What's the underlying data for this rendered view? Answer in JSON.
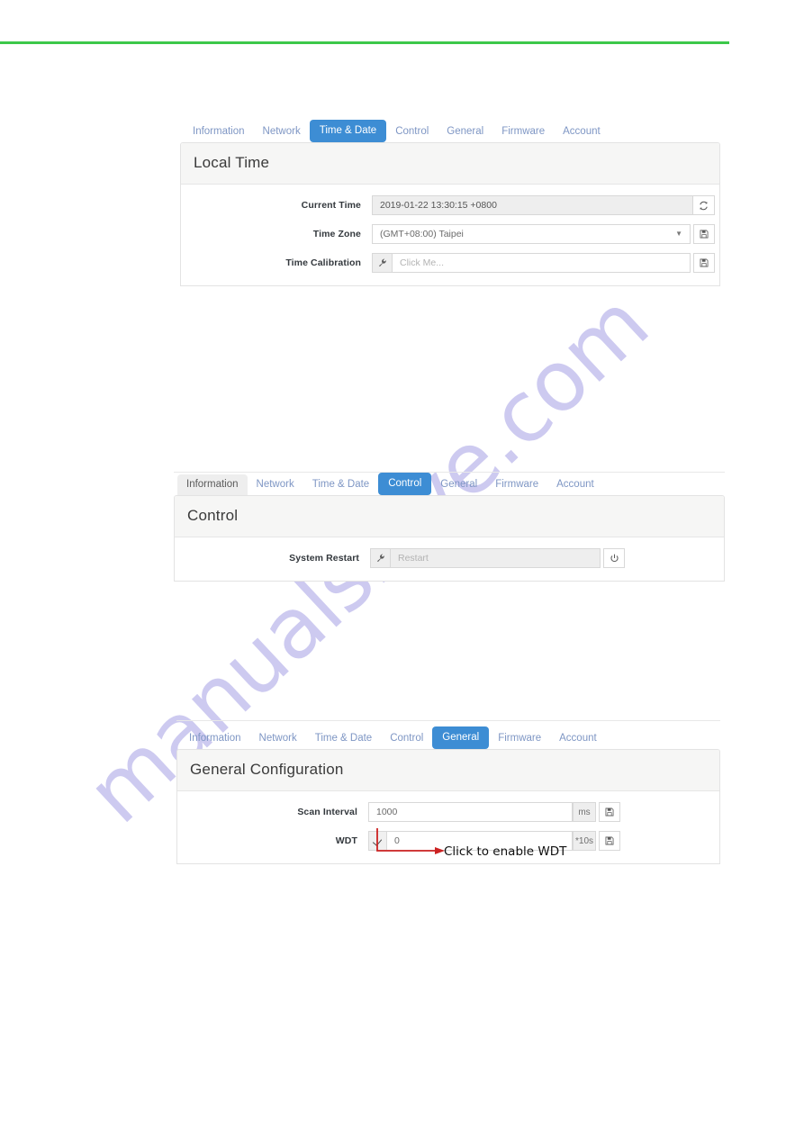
{
  "page": {
    "accent_green": "#3cc84a",
    "watermark_text": "manualshive.com",
    "watermark_color": "#c9c6ef"
  },
  "tabs_common": [
    "Information",
    "Network",
    "Time & Date",
    "Control",
    "General",
    "Firmware",
    "Account"
  ],
  "panels": [
    {
      "id": "time-and-date",
      "tabs": [
        {
          "label": "Information",
          "state": "normal"
        },
        {
          "label": "Network",
          "state": "normal"
        },
        {
          "label": "Time & Date",
          "state": "active"
        },
        {
          "label": "Control",
          "state": "normal"
        },
        {
          "label": "General",
          "state": "normal"
        },
        {
          "label": "Firmware",
          "state": "normal"
        },
        {
          "label": "Account",
          "state": "normal"
        }
      ],
      "title": "Local Time",
      "rows": [
        {
          "label": "Current Time",
          "value": "2019-01-22 13:30:15 +0800",
          "placeholder": "",
          "trailing_icon": "refresh-icon"
        },
        {
          "label": "Time Zone",
          "value": "(GMT+08:00) Taipei",
          "placeholder": "",
          "trailing_icon": "save-icon"
        },
        {
          "label": "Time Calibration",
          "value": "",
          "placeholder": "Click Me...",
          "leading_icon": "wrench-icon",
          "trailing_icon": "save-icon"
        }
      ]
    },
    {
      "id": "control",
      "tabs": [
        {
          "label": "Information",
          "state": "hovered"
        },
        {
          "label": "Network",
          "state": "normal"
        },
        {
          "label": "Time & Date",
          "state": "normal"
        },
        {
          "label": "Control",
          "state": "active"
        },
        {
          "label": "General",
          "state": "normal"
        },
        {
          "label": "Firmware",
          "state": "normal"
        },
        {
          "label": "Account",
          "state": "normal"
        }
      ],
      "title": "Control",
      "rows": [
        {
          "label": "System Restart",
          "value": "",
          "placeholder": "Restart",
          "leading_icon": "wrench-icon",
          "trailing_icon": "power-icon"
        }
      ]
    },
    {
      "id": "general",
      "tabs": [
        {
          "label": "Information",
          "state": "normal"
        },
        {
          "label": "Network",
          "state": "normal"
        },
        {
          "label": "Time & Date",
          "state": "normal"
        },
        {
          "label": "Control",
          "state": "normal"
        },
        {
          "label": "General",
          "state": "active"
        },
        {
          "label": "Firmware",
          "state": "normal"
        },
        {
          "label": "Account",
          "state": "normal"
        }
      ],
      "title": "General Configuration",
      "rows": [
        {
          "label": "Scan Interval",
          "value": "1000",
          "unit": "ms",
          "trailing_icon": "save-icon"
        },
        {
          "label": "WDT",
          "value": "0",
          "unit": "*10s",
          "leading_icon": "checkbox-checked-icon",
          "trailing_icon": "save-icon"
        }
      ]
    }
  ],
  "annotation": {
    "text": "Click to enable WDT",
    "color": "#cc2222"
  }
}
